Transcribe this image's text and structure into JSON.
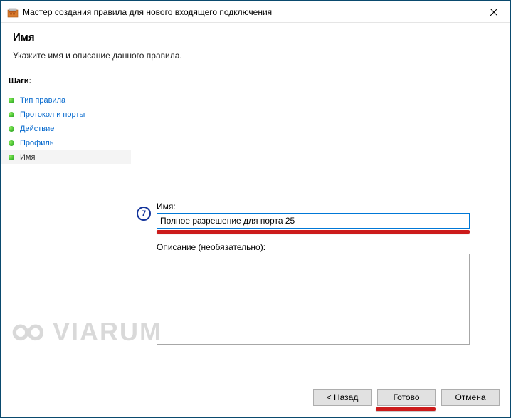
{
  "window": {
    "title": "Мастер создания правила для нового входящего подключения"
  },
  "header": {
    "title": "Имя",
    "subtitle": "Укажите имя и описание данного правила."
  },
  "sidebar": {
    "heading": "Шаги:",
    "steps": [
      {
        "label": "Тип правила",
        "current": false
      },
      {
        "label": "Протокол и порты",
        "current": false
      },
      {
        "label": "Действие",
        "current": false
      },
      {
        "label": "Профиль",
        "current": false
      },
      {
        "label": "Имя",
        "current": true
      }
    ]
  },
  "form": {
    "name_label": "Имя:",
    "name_value": "Полное разрешение для порта 25",
    "desc_label": "Описание (необязательно):",
    "desc_value": ""
  },
  "annotation": {
    "step_number": "7"
  },
  "buttons": {
    "back": "< Назад",
    "finish": "Готово",
    "cancel": "Отмена"
  },
  "watermark": "VIARUM"
}
